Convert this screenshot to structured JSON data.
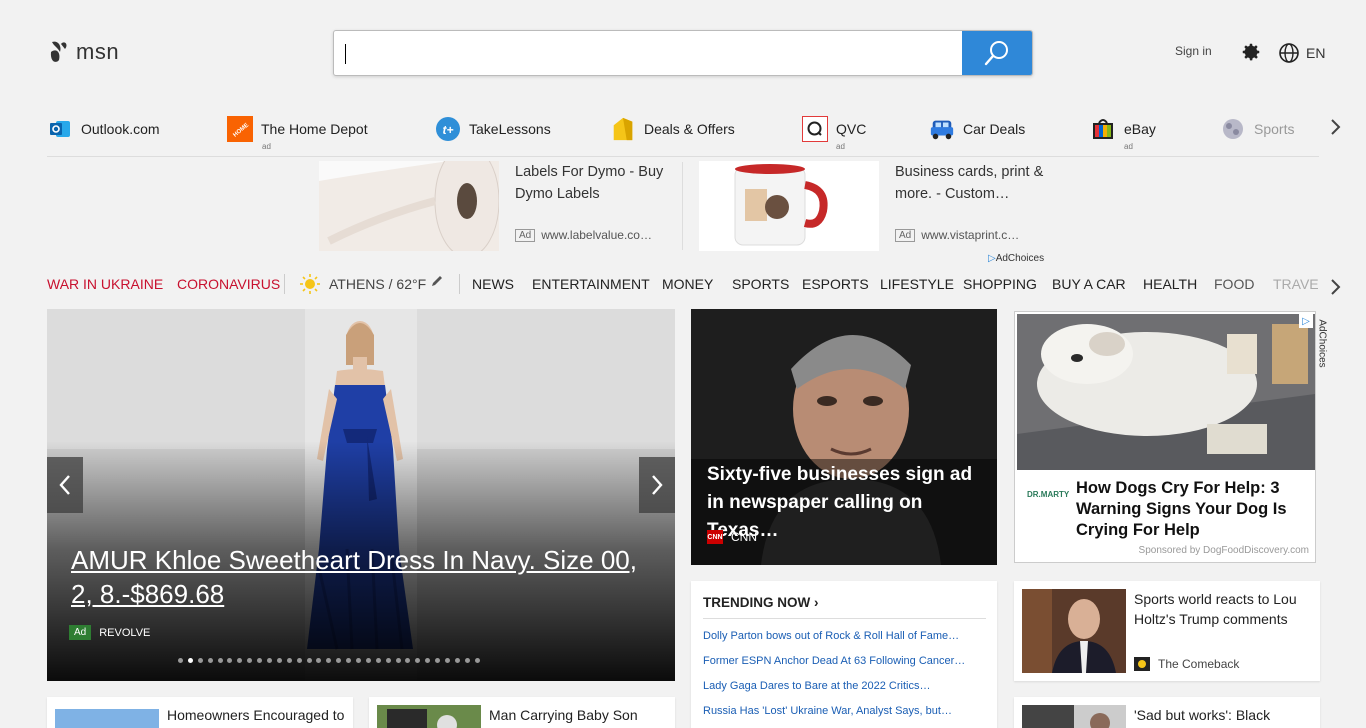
{
  "header": {
    "logo_text": "msn",
    "search_value": "",
    "signin_label": "Sign in",
    "lang_label": "EN"
  },
  "quicklinks": [
    {
      "label": "Outlook.com",
      "ad": ""
    },
    {
      "label": "The Home Depot",
      "ad": "ad"
    },
    {
      "label": "TakeLessons",
      "ad": ""
    },
    {
      "label": "Deals & Offers",
      "ad": ""
    },
    {
      "label": "QVC",
      "ad": "ad"
    },
    {
      "label": "Car Deals",
      "ad": ""
    },
    {
      "label": "eBay",
      "ad": "ad"
    },
    {
      "label": "Sports",
      "ad": ""
    }
  ],
  "ads": [
    {
      "title": "Labels For Dymo - Buy Dymo Labels",
      "badge": "Ad",
      "url": "www.labelvalue.co…"
    },
    {
      "title": "Business cards, print & more. - Custom…",
      "badge": "Ad",
      "url": "www.vistaprint.c…"
    }
  ],
  "adchoices_label": "AdChoices",
  "nav": {
    "highlight": [
      "WAR IN UKRAINE",
      "CORONAVIRUS"
    ],
    "weather": "ATHENS / 62°F",
    "items": [
      "NEWS",
      "ENTERTAINMENT",
      "MONEY",
      "SPORTS",
      "ESPORTS",
      "LIFESTYLE",
      "SHOPPING",
      "BUY A CAR",
      "HEALTH",
      "FOOD",
      "TRAVEL"
    ]
  },
  "hero": {
    "title": "AMUR Khloe Sweetheart Dress In Navy. Size 00, 2, 8.-$869.68",
    "ad_label": "Ad",
    "source": "REVOLVE",
    "slides_total": 31,
    "slide_active": 2
  },
  "cnn_card": {
    "title": "Sixty-five businesses sign ad in newspaper calling on Texas…",
    "logo": "CNN",
    "source": "CNN"
  },
  "dog_ad": {
    "brand": "DR.MARTY",
    "title": "How Dogs Cry For Help: 3 Warning Signs Your Dog Is Crying For Help",
    "sponsor": "Sponsored by DogFoodDiscovery.com",
    "adchoices": "AdChoices"
  },
  "trending": {
    "heading": "TRENDING NOW",
    "items": [
      "Dolly Parton bows out of Rock & Roll Hall of Fame…",
      "Former ESPN Anchor Dead At 63 Following Cancer…",
      "Lady Gaga Dares to Bare at the 2022 Critics…",
      "Russia Has 'Lost' Ukraine War, Analyst Says, but…"
    ]
  },
  "stories": {
    "holtz": {
      "title": "Sports world reacts to Lou Holtz's Trump comments",
      "source": "The Comeback"
    },
    "homeowners": {
      "title": "Homeowners Encouraged to"
    },
    "baby": {
      "title": "Man Carrying Baby Son"
    },
    "sad": {
      "title": "'Sad but works': Black"
    }
  }
}
